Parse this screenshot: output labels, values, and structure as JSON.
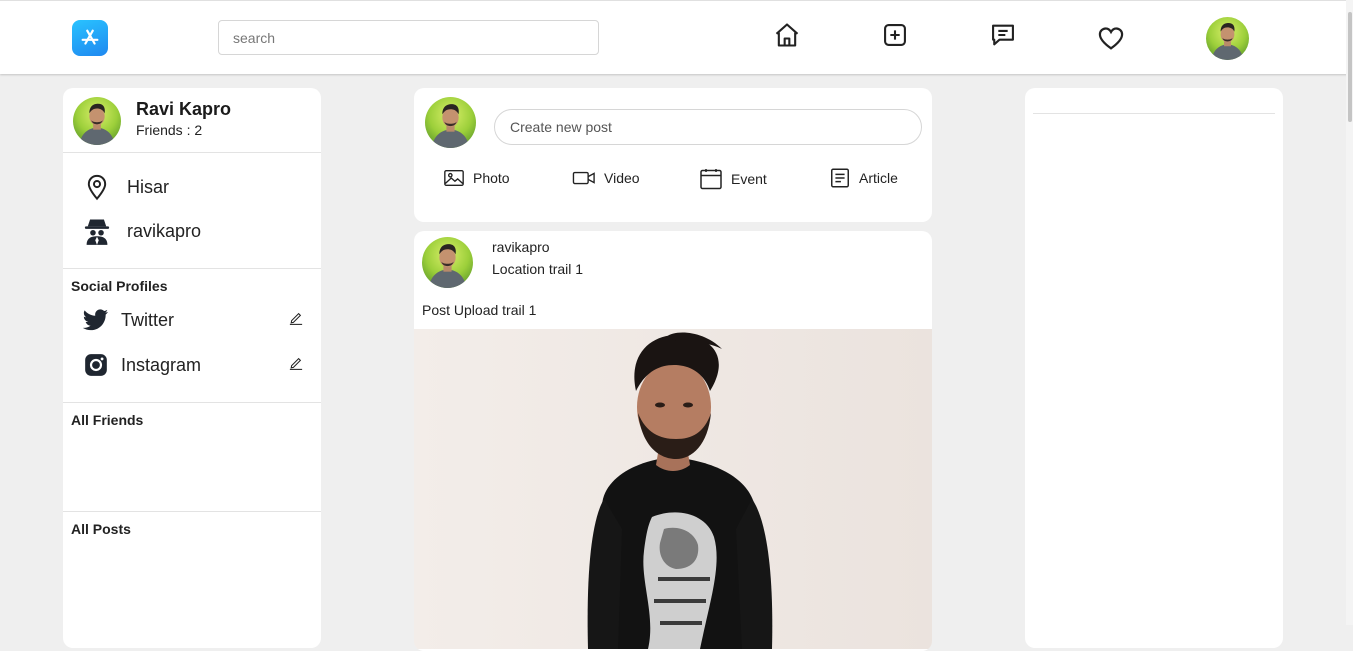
{
  "header": {
    "logo_icon": "app-store-icon",
    "search_placeholder": "search",
    "nav": [
      "home-icon",
      "add-post-icon",
      "messages-icon",
      "favorites-icon",
      "profile-avatar"
    ]
  },
  "profile": {
    "name": "Ravi Kapro",
    "friends_label": "Friends : 2",
    "location": "Hisar",
    "username": "ravikapro"
  },
  "social": {
    "title": "Social Profiles",
    "items": [
      {
        "label": "Twitter",
        "icon": "twitter-icon"
      },
      {
        "label": "Instagram",
        "icon": "instagram-icon"
      }
    ]
  },
  "friends_section": {
    "title": "All Friends"
  },
  "posts_section": {
    "title": "All Posts"
  },
  "create_post": {
    "placeholder": "Create new post",
    "actions": [
      "Photo",
      "Video",
      "Event",
      "Article"
    ]
  },
  "post": {
    "username": "ravikapro",
    "location": "Location trail 1",
    "caption": "Post Upload trail 1"
  },
  "colors": {
    "accent": "#1f88f0",
    "background": "#efefef",
    "card": "#ffffff"
  }
}
